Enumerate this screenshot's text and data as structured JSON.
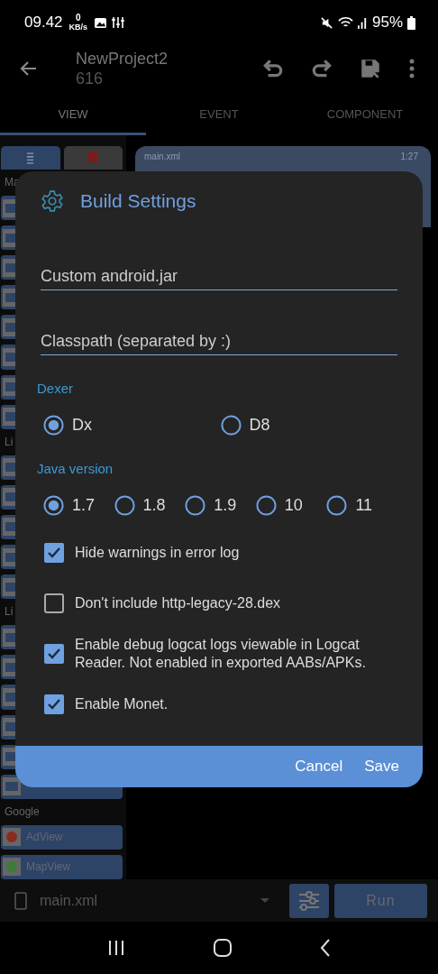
{
  "status_bar": {
    "time": "09.42",
    "speed_value": "0",
    "speed_unit": "KB/s",
    "battery": "95%"
  },
  "app_bar": {
    "title": "NewProject2",
    "subtitle": "616"
  },
  "tabs": [
    {
      "label": "VIEW",
      "selected": true
    },
    {
      "label": "EVENT",
      "selected": false
    },
    {
      "label": "COMPONENT",
      "selected": false
    }
  ],
  "palette": {
    "sections": [
      {
        "label": "Ma"
      },
      {
        "label": "Li"
      },
      {
        "label": "Li"
      },
      {
        "label": "Google",
        "items": [
          {
            "label": "AdView"
          },
          {
            "label": "MapView"
          }
        ]
      }
    ]
  },
  "preview": {
    "file": "main.xml",
    "time": "1:27"
  },
  "dialog": {
    "title": "Build Settings",
    "fields": [
      {
        "placeholder": "Custom android.jar"
      },
      {
        "placeholder": "Classpath (separated by :)"
      }
    ],
    "groups": [
      {
        "label": "Dexer",
        "options": [
          {
            "label": "Dx",
            "selected": true
          },
          {
            "label": "D8",
            "selected": false
          }
        ]
      },
      {
        "label": "Java version",
        "options": [
          {
            "label": "1.7",
            "selected": true
          },
          {
            "label": "1.8",
            "selected": false
          },
          {
            "label": "1.9",
            "selected": false
          },
          {
            "label": "10",
            "selected": false
          },
          {
            "label": "11",
            "selected": false
          }
        ]
      }
    ],
    "checks": [
      {
        "label": "Hide warnings in error log",
        "checked": true
      },
      {
        "label": "Don't include http-legacy-28.dex",
        "checked": false
      },
      {
        "label": "Enable debug logcat logs viewable in Logcat Reader. Not enabled in exported AABs/APKs.",
        "checked": true
      },
      {
        "label": "Enable Monet.",
        "checked": true
      }
    ],
    "buttons": [
      "Cancel",
      "Save"
    ]
  },
  "bottom_bar": {
    "file": "main.xml",
    "run": "Run"
  }
}
